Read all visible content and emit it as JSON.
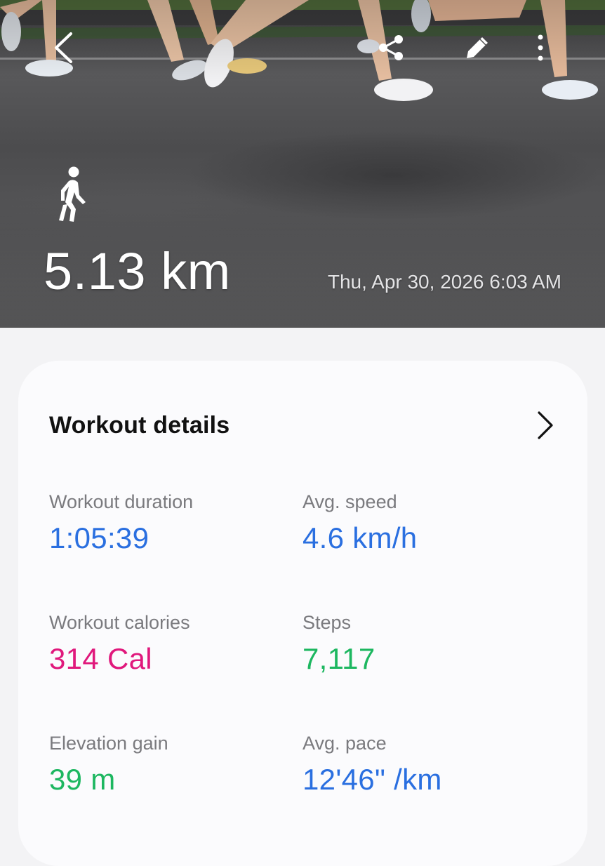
{
  "header": {
    "activity_icon": "walking-person-icon",
    "distance": "5.13 km",
    "date_time": "Thu, Apr 30, 2026 6:03 AM",
    "actions": [
      "back-icon",
      "share-icon",
      "edit-icon",
      "more-vert-icon"
    ]
  },
  "card": {
    "title": "Workout details",
    "stats": {
      "duration": {
        "label": "Workout duration",
        "value": "1:05:39"
      },
      "speed": {
        "label": "Avg. speed",
        "value": "4.6 km/h"
      },
      "calories": {
        "label": "Workout calories",
        "value": "314 Cal"
      },
      "steps": {
        "label": "Steps",
        "value": "7,117"
      },
      "elevation": {
        "label": "Elevation gain",
        "value": "39 m"
      },
      "pace": {
        "label": "Avg. pace",
        "value": "12'46\" /km"
      }
    }
  },
  "colors": {
    "blue": "#2a6fe0",
    "pink": "#e0187c",
    "green": "#1db760"
  }
}
